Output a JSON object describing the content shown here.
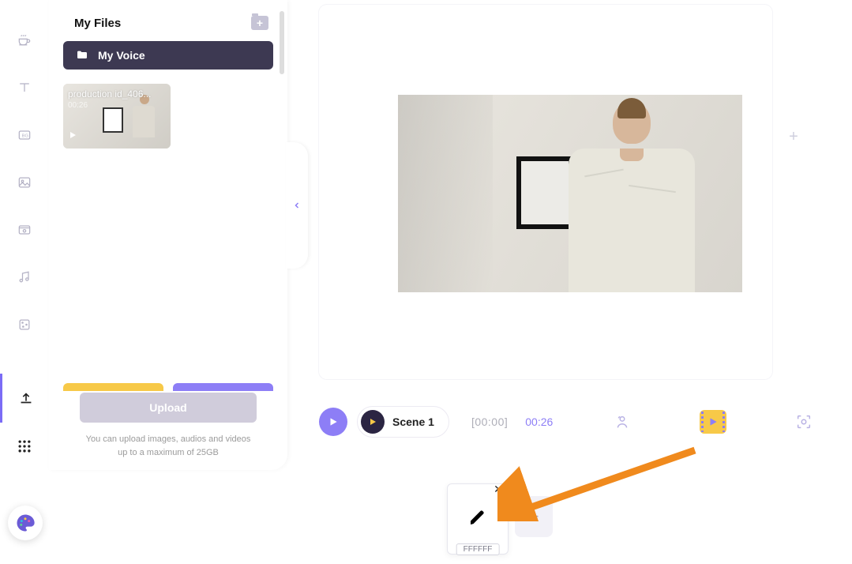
{
  "panel": {
    "title": "My Files",
    "folder": "My Voice",
    "thumb_label": "production id_406...",
    "thumb_time": "00:26",
    "upload_button": "Upload",
    "upload_hint_line1": "You can upload images, audios and videos",
    "upload_hint_line2": "up to a maximum of 25GB"
  },
  "toolbar": {
    "scene_label": "Scene 1",
    "time_total": "[00:00]",
    "time_current": "00:26"
  },
  "bottom": {
    "color_badge": "FFFFFF"
  },
  "rail_icons": [
    "coffee",
    "text",
    "background",
    "image",
    "video",
    "audio",
    "effects"
  ],
  "colors": {
    "accent": "#8d7ef6",
    "yellow": "#f7c948",
    "dark": "#3d3952"
  }
}
